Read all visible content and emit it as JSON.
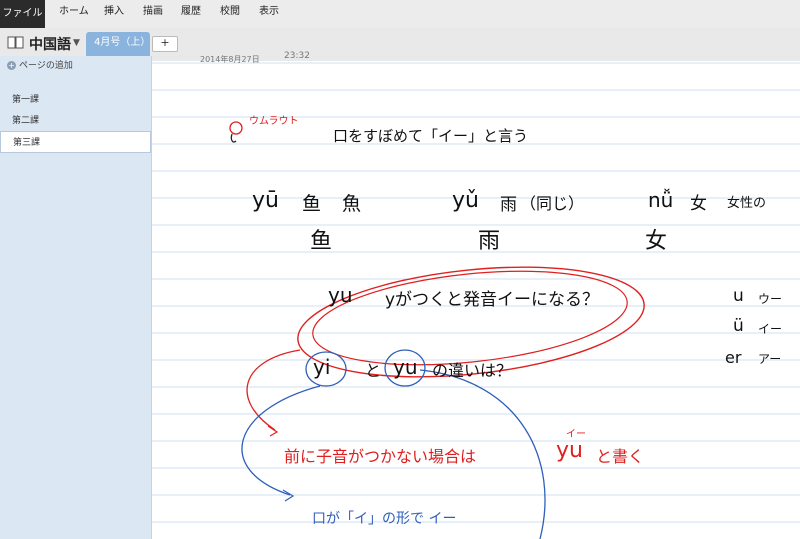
{
  "ribbon": {
    "file": "ファイル",
    "tabs": [
      "ホーム",
      "挿入",
      "描画",
      "履歴",
      "校閲",
      "表示"
    ]
  },
  "notebook": {
    "name": "中国語",
    "section": "4月号（上）",
    "add_tab": "+"
  },
  "sidebar": {
    "add_page": "ページの追加",
    "pages": [
      "第一課",
      "第二課",
      "第三課"
    ],
    "active_index": 2
  },
  "page": {
    "date": "2014年8月27日",
    "time": "23:32"
  },
  "ink": {
    "umlaut_label": "ウムラウト",
    "line1": "口をすぼめて「イー」と言う",
    "yu_1": "yū",
    "yu_1_a": "鱼",
    "yu_1_b": "魚",
    "yu_3": "yǔ",
    "yu_3_a": "雨",
    "yu_3_b": "（同じ）",
    "nu_3": "nǚ",
    "nu_3_a": "女",
    "nu_3_b": "女性の",
    "row2_a": "鱼",
    "row2_b": "雨",
    "row2_c": "女",
    "q1_yu": "yu",
    "q1": "yがつくと発音イーになる？",
    "q2_yi": "yi",
    "q2_to": "と",
    "q2_yu": "yu",
    "q2_rest": "の違いは？",
    "side_u": "u",
    "side_u_r": "ウー",
    "side_uu": "ü",
    "side_uu_r": "イー",
    "side_er": "er",
    "side_er_r": "アー",
    "red_note": "前に子音がつかない場合は",
    "red_yu": "yu",
    "red_tail": "と書く",
    "red_small": "イー",
    "blue_note": "口が「イ」の形で イー"
  },
  "colors": {
    "red_ink": "#e02020",
    "blue_ink": "#2f5fb8",
    "rule_line": "#cfe0f3",
    "section_tab": "#8ab3de",
    "sidebar": "#dce7f4"
  }
}
